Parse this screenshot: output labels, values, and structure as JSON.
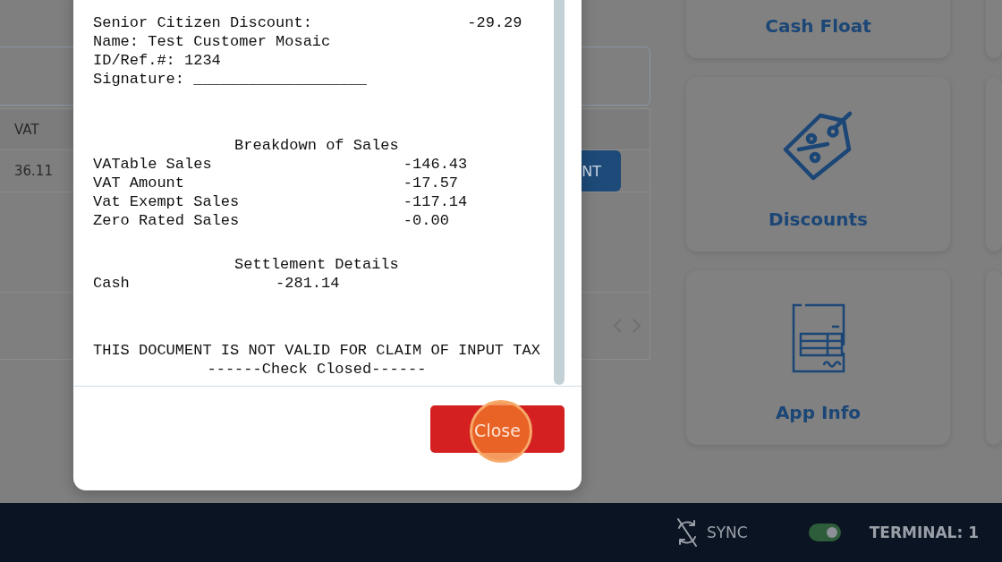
{
  "table": {
    "columns": [
      {
        "label": "VAT"
      }
    ],
    "rows": [
      {
        "cells": [
          "36.11"
        ],
        "action": "NT"
      }
    ]
  },
  "cards": [
    {
      "label": "Cash Float",
      "kind": "plain"
    },
    {
      "label": "Discounts",
      "kind": "discount"
    },
    {
      "label": "App Info",
      "kind": "document"
    }
  ],
  "receipt": {
    "sections": [
      {
        "lines": [
          {
            "kind": "line",
            "text": "Senior Citizen Discount:                 -29.29"
          },
          {
            "kind": "line",
            "text": "Name: Test Customer Mosaic"
          },
          {
            "kind": "line",
            "text": "ID/Ref.#: 1234"
          },
          {
            "kind": "line",
            "text": "Signature: ___________________"
          }
        ]
      },
      {
        "lines": [
          {
            "kind": "center",
            "text": "Breakdown of Sales"
          },
          {
            "kind": "line",
            "text": "VATable Sales                     -146.43"
          },
          {
            "kind": "line",
            "text": "VAT Amount                        -17.57"
          },
          {
            "kind": "line",
            "text": "Vat Exempt Sales                  -117.14"
          },
          {
            "kind": "line",
            "text": "Zero Rated Sales                  -0.00"
          }
        ]
      },
      {
        "lines": [
          {
            "kind": "center",
            "text": "Settlement Details"
          },
          {
            "kind": "line",
            "text": "Cash                -281.14"
          }
        ]
      },
      {
        "lines": [
          {
            "kind": "line",
            "text": "THIS DOCUMENT IS NOT VALID FOR CLAIM OF INPUT TAX"
          },
          {
            "kind": "center",
            "text": "------Check Closed------"
          }
        ]
      }
    ]
  },
  "dialog_buttons": [
    {
      "label": "Close",
      "kind": "danger",
      "highlighted": true
    }
  ],
  "status_bar": {
    "sync": {
      "label": "SYNC"
    },
    "toggle": {
      "on": true
    },
    "terminal": "TERMINAL: 1"
  }
}
